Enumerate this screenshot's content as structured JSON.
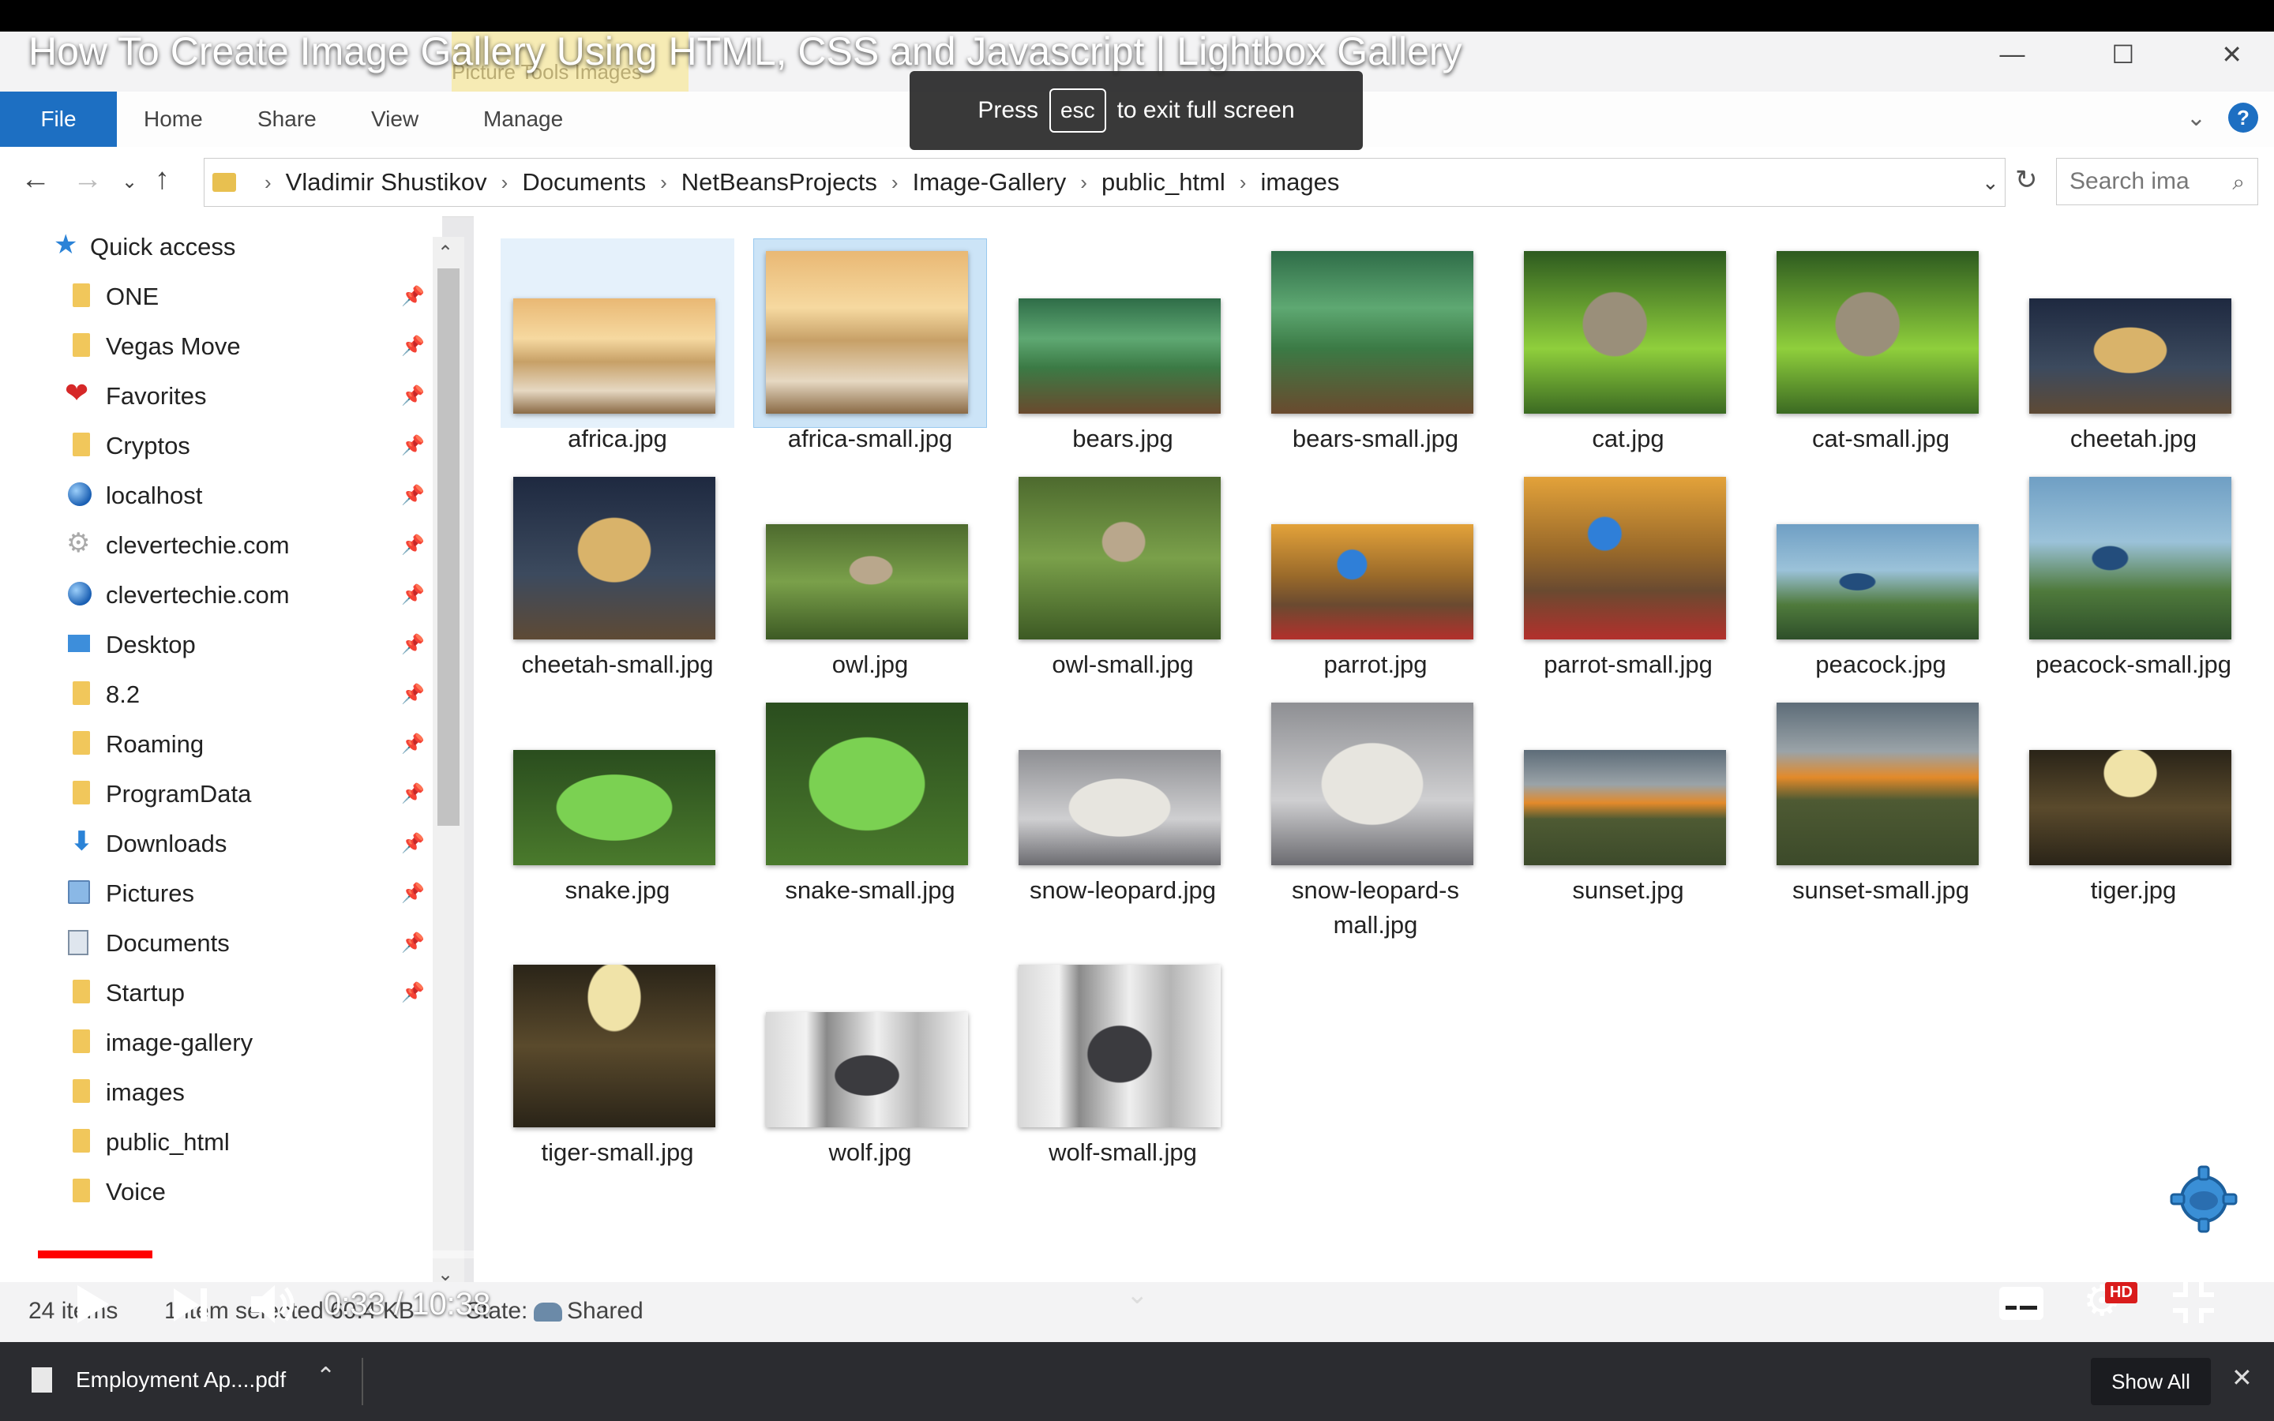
{
  "video": {
    "title": "How To Create Image Gallery Using HTML, CSS and Javascript | Lightbox Gallery",
    "toast_press": "Press",
    "toast_key": "esc",
    "toast_suffix": "to exit full screen",
    "time": "0:33 / 10:38",
    "progress": 0.052,
    "hd_label": "HD"
  },
  "window": {
    "context_tab_ghost": "Picture Tools   Images",
    "controls": [
      "—",
      "☐",
      "✕"
    ]
  },
  "ribbon": {
    "tabs": [
      "File",
      "Home",
      "Share",
      "View",
      "Manage"
    ]
  },
  "address": {
    "crumbs": [
      "Vladimir Shustikov",
      "Documents",
      "NetBeansProjects",
      "Image-Gallery",
      "public_html",
      "images"
    ],
    "search_placeholder": "Search ima"
  },
  "sidebar": {
    "items": [
      {
        "label": "Quick access",
        "icon": "star-icon",
        "pinned": false
      },
      {
        "label": "ONE",
        "icon": "folder-icon",
        "pinned": true
      },
      {
        "label": "Vegas Move",
        "icon": "folder-icon",
        "pinned": true
      },
      {
        "label": "Favorites",
        "icon": "heart-icon",
        "pinned": true
      },
      {
        "label": "Cryptos",
        "icon": "folder-icon",
        "pinned": true
      },
      {
        "label": "localhost",
        "icon": "globe-icon",
        "pinned": true
      },
      {
        "label": "clevertechie.com",
        "icon": "gear-icon",
        "pinned": true
      },
      {
        "label": "clevertechie.com",
        "icon": "globe-icon",
        "pinned": true
      },
      {
        "label": "Desktop",
        "icon": "desktop-icon",
        "pinned": true
      },
      {
        "label": "8.2",
        "icon": "folder-icon",
        "pinned": true
      },
      {
        "label": "Roaming",
        "icon": "folder-icon",
        "pinned": true
      },
      {
        "label": "ProgramData",
        "icon": "folder-icon",
        "pinned": true
      },
      {
        "label": "Downloads",
        "icon": "download-icon",
        "pinned": true
      },
      {
        "label": "Pictures",
        "icon": "pictures-icon",
        "pinned": true
      },
      {
        "label": "Documents",
        "icon": "documents-icon",
        "pinned": true
      },
      {
        "label": "Startup",
        "icon": "folder-icon",
        "pinned": true
      },
      {
        "label": "image-gallery",
        "icon": "folder-icon",
        "pinned": false
      },
      {
        "label": "images",
        "icon": "folder-icon",
        "pinned": false
      },
      {
        "label": "public_html",
        "icon": "folder-icon",
        "pinned": false
      },
      {
        "label": "Voice",
        "icon": "folder-icon",
        "pinned": false
      }
    ]
  },
  "files": [
    {
      "name": "africa.jpg",
      "scene": "savanna",
      "tall": false,
      "state": "hovered"
    },
    {
      "name": "africa-small.jpg",
      "scene": "savanna",
      "tall": true,
      "state": "selected"
    },
    {
      "name": "bears.jpg",
      "scene": "forest",
      "tall": false,
      "state": ""
    },
    {
      "name": "bears-small.jpg",
      "scene": "forest",
      "tall": true,
      "state": ""
    },
    {
      "name": "cat.jpg",
      "scene": "cat",
      "tall": true,
      "state": ""
    },
    {
      "name": "cat-small.jpg",
      "scene": "cat",
      "tall": true,
      "state": ""
    },
    {
      "name": "cheetah.jpg",
      "scene": "cheetah",
      "tall": false,
      "state": ""
    },
    {
      "name": "cheetah-small.jpg",
      "scene": "cheetah",
      "tall": true,
      "state": ""
    },
    {
      "name": "owl.jpg",
      "scene": "owl",
      "tall": false,
      "state": ""
    },
    {
      "name": "owl-small.jpg",
      "scene": "owl",
      "tall": true,
      "state": ""
    },
    {
      "name": "parrot.jpg",
      "scene": "parrot",
      "tall": false,
      "state": ""
    },
    {
      "name": "parrot-small.jpg",
      "scene": "parrot",
      "tall": true,
      "state": ""
    },
    {
      "name": "peacock.jpg",
      "scene": "peacock",
      "tall": false,
      "state": ""
    },
    {
      "name": "peacock-small.jpg",
      "scene": "peacock",
      "tall": true,
      "state": ""
    },
    {
      "name": "snake.jpg",
      "scene": "snake",
      "tall": false,
      "state": ""
    },
    {
      "name": "snake-small.jpg",
      "scene": "snake",
      "tall": true,
      "state": ""
    },
    {
      "name": "snow-leopard.jpg",
      "scene": "leopard",
      "tall": false,
      "state": ""
    },
    {
      "name": "snow-leopard-small.jpg",
      "scene": "leopard",
      "tall": true,
      "state": ""
    },
    {
      "name": "sunset.jpg",
      "scene": "sunset",
      "tall": false,
      "state": ""
    },
    {
      "name": "sunset-small.jpg",
      "scene": "sunset",
      "tall": true,
      "state": ""
    },
    {
      "name": "tiger.jpg",
      "scene": "tiger",
      "tall": false,
      "state": ""
    },
    {
      "name": "tiger-small.jpg",
      "scene": "tiger",
      "tall": true,
      "state": ""
    },
    {
      "name": "wolf.jpg",
      "scene": "wolf",
      "tall": false,
      "state": ""
    },
    {
      "name": "wolf-small.jpg",
      "scene": "wolf",
      "tall": true,
      "state": ""
    }
  ],
  "status": {
    "count": "24 items",
    "selected": "1 item selected  60.4 KB",
    "state_label": "State:",
    "state_value": "Shared"
  },
  "downloads": {
    "file": "Employment Ap....pdf",
    "show_all": "Show All"
  },
  "colors": {
    "accent": "#1d6fc2",
    "progress": "#ff0000",
    "selection": "#cce4f7"
  }
}
